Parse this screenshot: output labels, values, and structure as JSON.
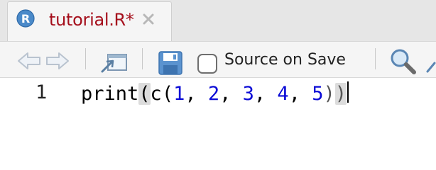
{
  "tab": {
    "title": "tutorial.R*",
    "icon": "r-logo-icon",
    "close_icon": "close-icon"
  },
  "toolbar": {
    "back_icon": "arrow-left-icon",
    "forward_icon": "arrow-right-icon",
    "show_in_window_icon": "show-in-new-window-icon",
    "save_icon": "save-icon",
    "source_on_save_label": "Source on Save",
    "source_on_save_checked": false,
    "search_icon": "search-icon",
    "wand_icon": "code-tools-icon"
  },
  "editor": {
    "line_number": "1",
    "tokens": {
      "fn": "print",
      "open1": "(",
      "fn2": "c",
      "open2": "(",
      "n1": "1",
      "sep1": ", ",
      "n2": "2",
      "sep2": ", ",
      "n3": "3",
      "sep3": ", ",
      "n4": "4",
      "sep4": ", ",
      "n5": "5",
      "close2": ")",
      "close1": ")"
    }
  },
  "colors": {
    "tab_title": "#a50f1c",
    "number": "#0a0ad6",
    "bracket_highlight": "#dcdcdc"
  }
}
